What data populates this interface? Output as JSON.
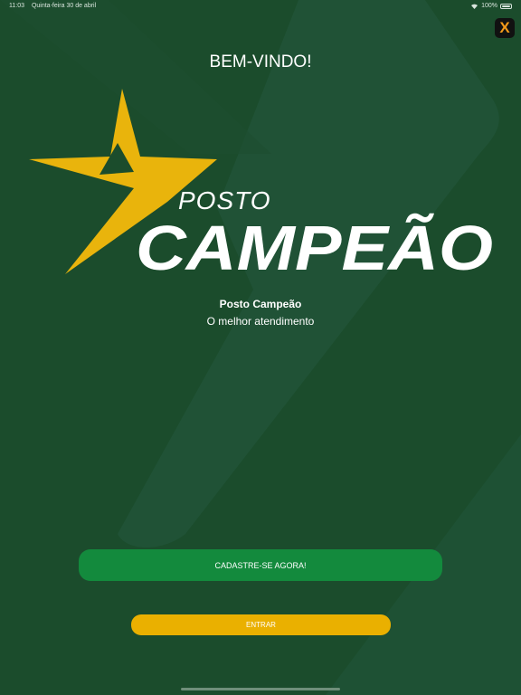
{
  "status_bar": {
    "time": "11:03",
    "date": "Quinta-feira 30 de abril",
    "battery": "100%"
  },
  "app_badge": {
    "letter": "X"
  },
  "welcome": {
    "title": "BEM-VINDO!"
  },
  "logo": {
    "line1": "POSTO",
    "line2": "CAMPEÃO"
  },
  "brand": {
    "name": "Posto Campeão",
    "tagline": "O melhor atendimento"
  },
  "actions": {
    "register_label": "CADASTRE-SE AGORA!",
    "enter_label": "ENTRAR"
  },
  "colors": {
    "background": "#1b4c2c",
    "star_gold": "#e9b40c",
    "register_green": "#138a3d",
    "enter_yellow": "#eab000"
  }
}
